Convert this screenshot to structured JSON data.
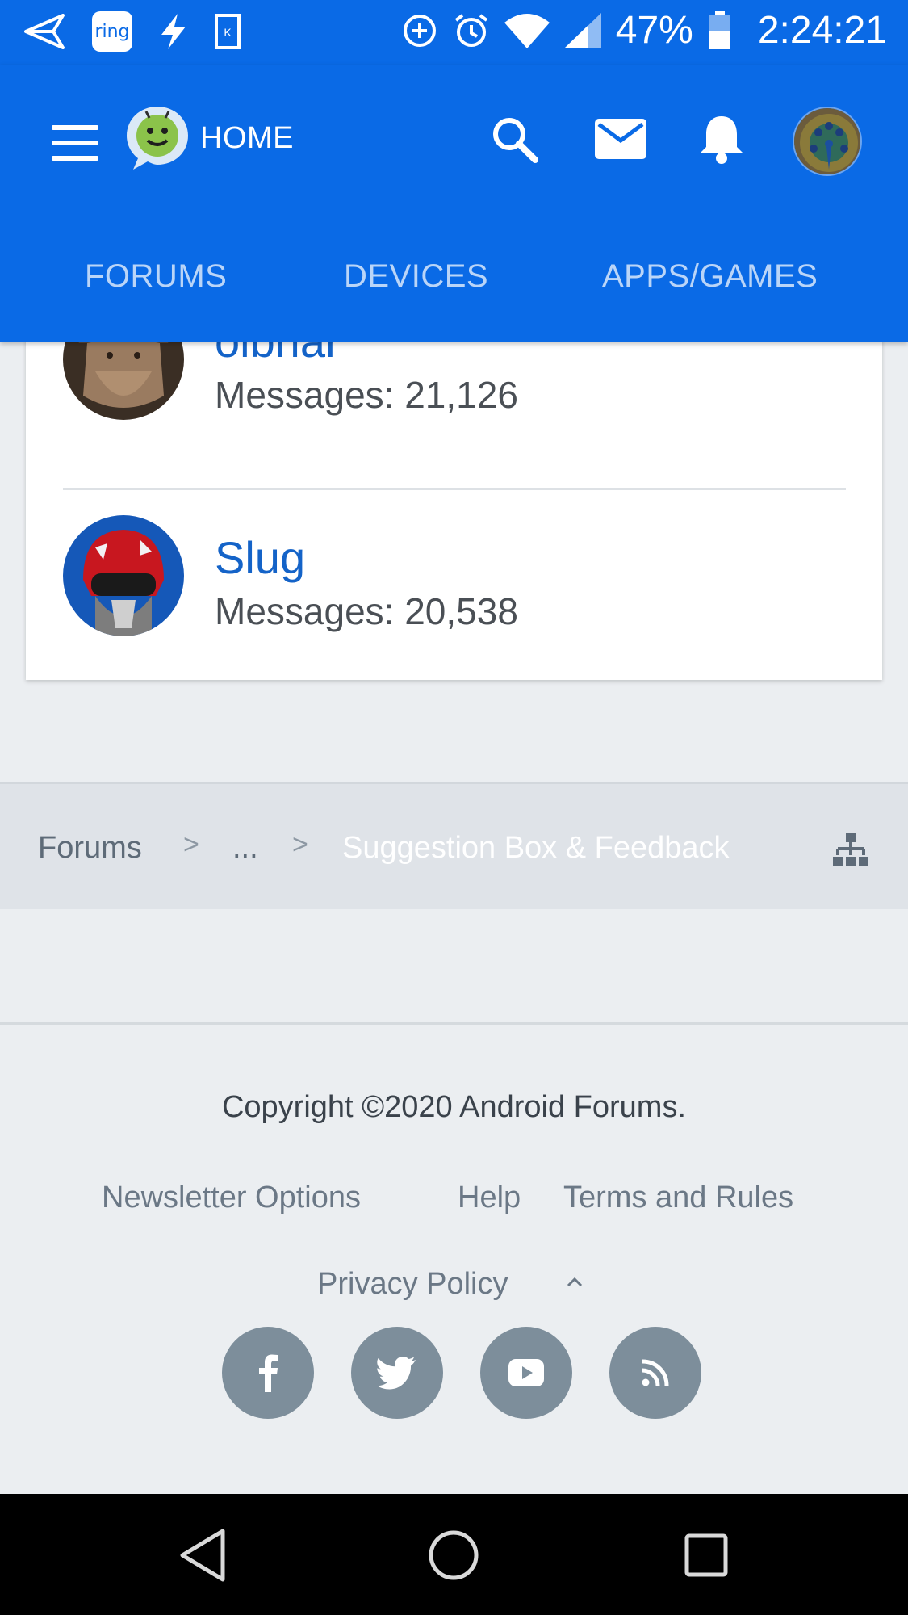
{
  "status_bar": {
    "ring_label": "ring",
    "battery": "47%",
    "time": "2:24:21"
  },
  "header": {
    "home_label": "HOME",
    "tabs": [
      {
        "label": "FORUMS"
      },
      {
        "label": "DEVICES"
      },
      {
        "label": "APPS/GAMES"
      }
    ]
  },
  "members": [
    {
      "name": "olbriar",
      "messages": "Messages: 21,126"
    },
    {
      "name": "Slug",
      "messages": "Messages: 20,538"
    }
  ],
  "breadcrumb": {
    "items": [
      "Forums",
      "...",
      "Suggestion Box & Feedback"
    ],
    "separator": ">"
  },
  "footer": {
    "copyright": "Copyright ©2020 Android Forums.",
    "links": [
      "Newsletter Options",
      "Help",
      "Terms and Rules",
      "Privacy Policy"
    ],
    "social": [
      "facebook-icon",
      "twitter-icon",
      "youtube-icon",
      "rss-icon"
    ]
  },
  "colors": {
    "brand_blue": "#0a6ae6",
    "link_blue": "#1463c8",
    "social_gray": "#7d8e9b"
  }
}
